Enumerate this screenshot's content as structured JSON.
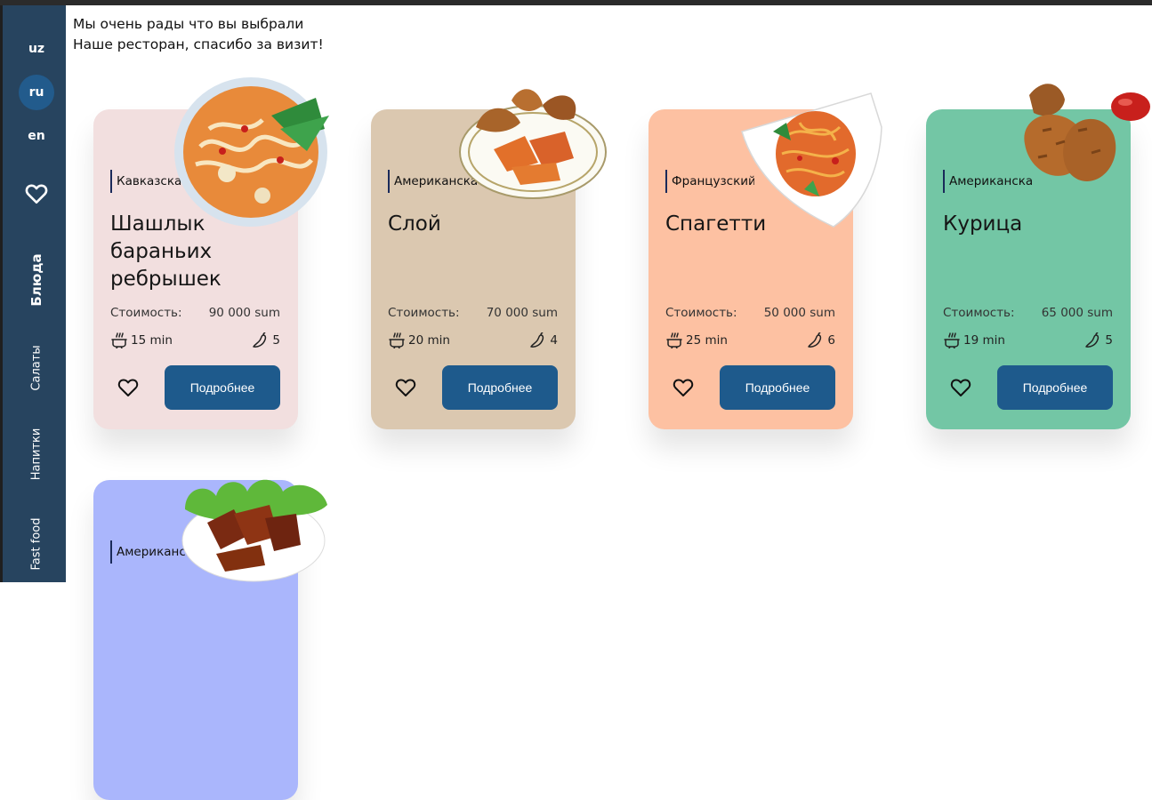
{
  "sidebar": {
    "languages": [
      {
        "code": "uz",
        "active": false
      },
      {
        "code": "ru",
        "active": true
      },
      {
        "code": "en",
        "active": false
      }
    ],
    "nav": [
      "Блюда",
      "Салаты",
      "Напитки",
      "Fast food"
    ]
  },
  "welcome": {
    "line1": "Мы очень рады что  вы выбрали",
    "line2": "Наше ресторан, спасибо за визит!"
  },
  "labels": {
    "price": "Стоимость:",
    "more": "Подробнее"
  },
  "cards": [
    {
      "category": "Кавказская кухня",
      "title": "Шашлык бараньих ребрышек",
      "price": "90 000 sum",
      "time": "15 min",
      "spice": "5",
      "bg": "#f2dfdf",
      "icon": "noodle-soup-bowl"
    },
    {
      "category": "Американская кухня",
      "title": "Слой",
      "price": "70 000 sum",
      "time": "20 min",
      "spice": "4",
      "bg": "#dbc8b0",
      "icon": "fried-chicken-wedges-plate"
    },
    {
      "category": "Французский",
      "title": "Спагетти",
      "price": "50 000 sum",
      "time": "25 min",
      "spice": "6",
      "bg": "#fdc1a2",
      "icon": "spaghetti-plate"
    },
    {
      "category": "Американская кухня",
      "title": "Курица",
      "price": "65 000 sum",
      "time": "19 min",
      "spice": "5",
      "bg": "#73c6a5",
      "icon": "fried-chicken"
    },
    {
      "category": "Американская кухня",
      "title": "",
      "price": "",
      "time": "",
      "spice": "",
      "bg": "#aab6fc",
      "icon": "bbq-ribs-plate"
    }
  ]
}
